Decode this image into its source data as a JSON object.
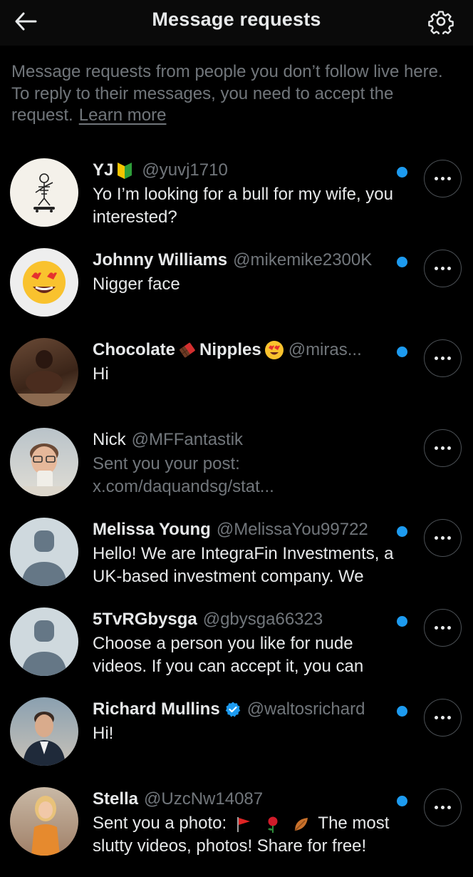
{
  "header": {
    "title": "Message requests",
    "back_icon": "arrow-left-icon",
    "settings_icon": "gear-icon"
  },
  "info": {
    "text": "Message requests from people you don’t follow live here. To reply to their messages, you need to accept the request.",
    "link": "Learn more"
  },
  "colors": {
    "background": "#000000",
    "text": "#e7e9ea",
    "muted": "#71767b",
    "unread_dot": "#1d9bf0",
    "verified": "#1d9bf0"
  },
  "requests": [
    {
      "name": "YJ",
      "handle": "@yuvj1710",
      "message": "Yo I’m looking for a bull for my wife, you interested?",
      "unread": true
    },
    {
      "name": "Johnny Williams",
      "handle": "@mikemike2300K",
      "message": "Nigger face",
      "unread": true
    },
    {
      "name_part1": "Chocolate",
      "name_part2": "Nipples",
      "handle": "@miras...",
      "message": "Hi",
      "unread": true
    },
    {
      "name": "Nick",
      "handle": "@MFFantastik",
      "message": "Sent you your post: x.com/daquandsg/stat...",
      "unread": false
    },
    {
      "name": "Melissa Young",
      "handle": "@MelissaYou99722",
      "message": "Hello! We are IntegraFin Investments, a UK-based investment company. We",
      "unread": true
    },
    {
      "name": "5TvRGbysga",
      "handle": "@gbysga66323",
      "message": "Choose a person you like for nude videos. If you can accept it, you can",
      "unread": true
    },
    {
      "name": "Richard Mullins",
      "handle": "@waltosrichard",
      "message": "Hi!",
      "unread": true,
      "verified": true
    },
    {
      "name": "Stella",
      "handle": "@UzcNw14087",
      "message_prefix": "Sent you a photo:",
      "message_suffix": "The most slutty videos, photos! Share for free!",
      "unread": true
    }
  ]
}
